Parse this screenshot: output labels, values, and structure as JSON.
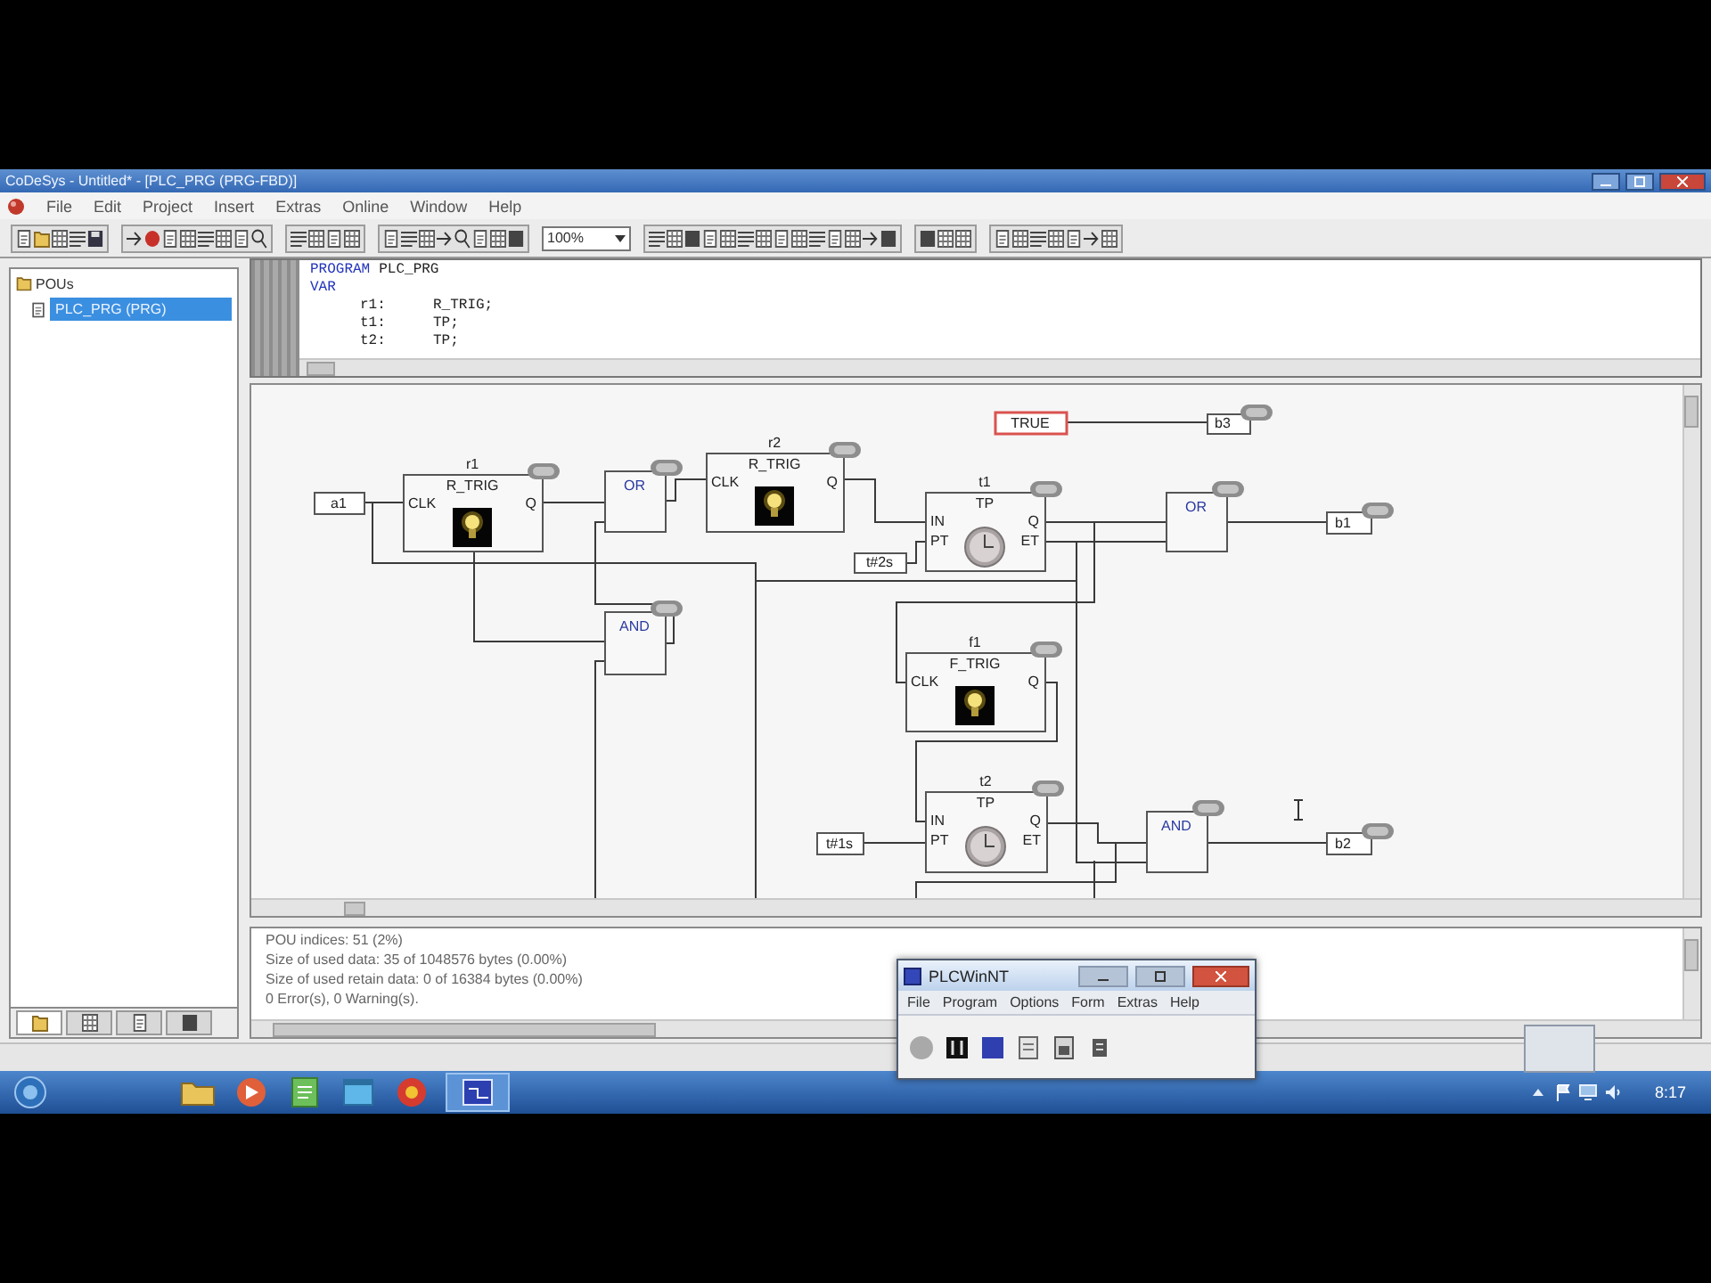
{
  "window": {
    "title": "CoDeSys - Untitled* - [PLC_PRG (PRG-FBD)]"
  },
  "menu": [
    "File",
    "Edit",
    "Project",
    "Insert",
    "Extras",
    "Online",
    "Window",
    "Help"
  ],
  "toolbar": {
    "combo_value": "100%"
  },
  "object_tree": {
    "root": "POUs",
    "items": [
      {
        "label": "PLC_PRG (PRG)",
        "selected": true
      }
    ]
  },
  "object_tabs": [
    {
      "selected": true
    },
    {
      "selected": false
    },
    {
      "selected": false
    },
    {
      "selected": false
    }
  ],
  "declaration": {
    "lines": [
      {
        "kind": "keyword",
        "keyword": "PROGRAM",
        "text": "PLC_PRG"
      },
      {
        "kind": "keyword",
        "keyword": "VAR"
      },
      {
        "kind": "variable",
        "name": "r1:",
        "type": "R_TRIG;"
      },
      {
        "kind": "variable",
        "name": "t1:",
        "type": "TP;"
      },
      {
        "kind": "variable",
        "name": "t2:",
        "type": "TP;"
      }
    ]
  },
  "diagram": {
    "elements": [
      {
        "kind": "input",
        "text": "a1",
        "selected": false
      },
      {
        "kind": "trigger",
        "instance": "r1",
        "type": "R_TRIG",
        "inputs": [
          "CLK"
        ],
        "outputs": [
          "Q"
        ],
        "selected": false
      },
      {
        "kind": "gate",
        "type": "OR",
        "selected": false
      },
      {
        "kind": "trigger",
        "instance": "r2",
        "type": "R_TRIG",
        "inputs": [
          "CLK"
        ],
        "outputs": [
          "Q"
        ],
        "selected": false
      },
      {
        "kind": "input",
        "text": "TRUE",
        "selected": true
      },
      {
        "kind": "output",
        "text": "b3",
        "selected": false
      },
      {
        "kind": "timer",
        "instance": "t1",
        "type": "TP",
        "inputs": [
          "IN",
          "PT"
        ],
        "outputs": [
          "Q",
          "ET"
        ],
        "selected": false
      },
      {
        "kind": "input",
        "text": "t#2s",
        "selected": false
      },
      {
        "kind": "gate",
        "type": "OR",
        "selected": false
      },
      {
        "kind": "output",
        "text": "b1",
        "selected": false
      },
      {
        "kind": "gate",
        "type": "AND",
        "selected": false
      },
      {
        "kind": "trigger",
        "instance": "f1",
        "type": "F_TRIG",
        "inputs": [
          "CLK"
        ],
        "outputs": [
          "Q"
        ],
        "selected": false
      },
      {
        "kind": "timer",
        "instance": "t2",
        "type": "TP",
        "inputs": [
          "IN",
          "PT"
        ],
        "outputs": [
          "Q",
          "ET"
        ],
        "selected": false
      },
      {
        "kind": "input",
        "text": "t#1s",
        "selected": false
      },
      {
        "kind": "gate",
        "type": "AND",
        "selected": false
      },
      {
        "kind": "output",
        "text": "b2",
        "selected": false
      }
    ]
  },
  "messages": [
    "POU indices: 51 (2%)",
    "Size of used data: 35 of 1048576 bytes (0.00%)",
    "Size of used retain data: 0 of 16384 bytes (0.00%)",
    "0 Error(s), 0 Warning(s)."
  ],
  "plc_window": {
    "title": "PLCWinNT",
    "menu": [
      "File",
      "Program",
      "Options",
      "Form",
      "Extras",
      "Help"
    ]
  },
  "taskbar": {
    "clock": "8:17"
  }
}
